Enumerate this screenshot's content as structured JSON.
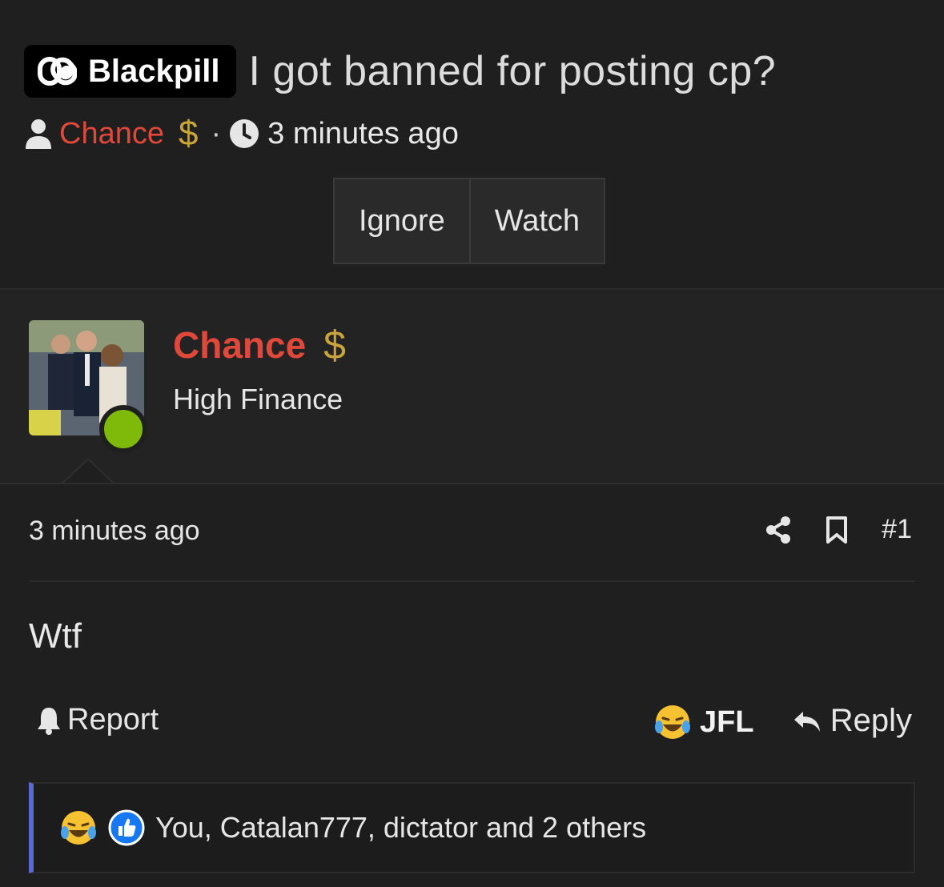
{
  "thread": {
    "prefix_label": "Blackpill",
    "prefix_icon": "pill-icon",
    "title": "I got banned for posting cp?",
    "author": "Chance",
    "author_badge": "$",
    "meta_separator": "·",
    "time": "3 minutes ago"
  },
  "buttons": {
    "ignore": "Ignore",
    "watch": "Watch"
  },
  "post_user": {
    "name": "Chance",
    "badge": "$",
    "title": "High Finance",
    "online": true
  },
  "post": {
    "time": "3 minutes ago",
    "number": "#1",
    "body": "Wtf"
  },
  "actions": {
    "report": "Report",
    "jfl": "JFL",
    "reply": "Reply"
  },
  "reactions": {
    "text": "You, Catalan777, dictator and 2 others",
    "icons": [
      "laughing-crying-emoji-icon",
      "thumbs-up-icon"
    ]
  },
  "colors": {
    "background": "#1f1f1f",
    "username": "#e0483a",
    "badge_gold": "#c9a43a",
    "online": "#7fba0b",
    "reaction_bar": "#5a6ad2"
  }
}
